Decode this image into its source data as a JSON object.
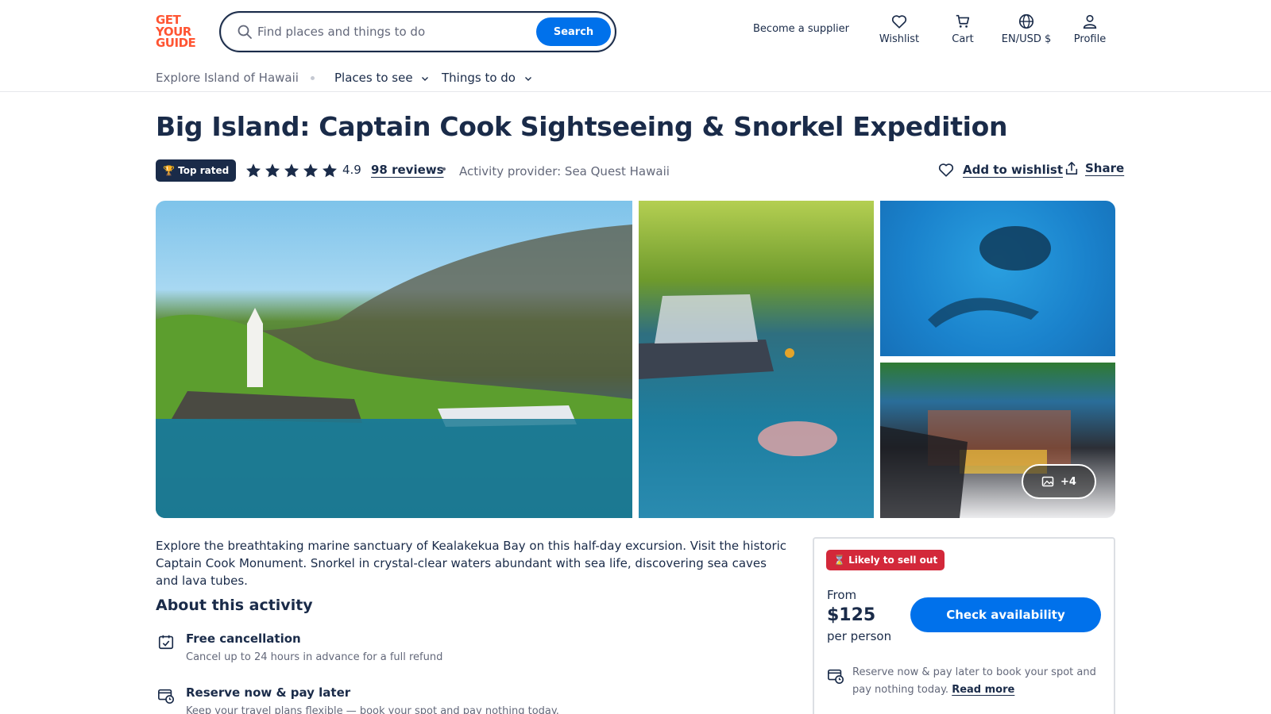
{
  "header": {
    "logo_lines": [
      "GET",
      "YOUR",
      "GUIDE"
    ],
    "search": {
      "placeholder": "Find places and things to do",
      "button_label": "Search"
    },
    "supplier_link": "Become a supplier",
    "nav": [
      {
        "label": "Wishlist",
        "icon": "heart-icon"
      },
      {
        "label": "Cart",
        "icon": "cart-icon"
      },
      {
        "label": "EN/USD $",
        "icon": "globe-icon"
      },
      {
        "label": "Profile",
        "icon": "profile-icon"
      }
    ]
  },
  "subnav": {
    "explore": "Explore Island of Hawaii",
    "menus": [
      {
        "label": "Places to see"
      },
      {
        "label": "Things to do"
      }
    ]
  },
  "activity": {
    "title": "Big Island: Captain Cook Sightseeing & Snorkel Expedition",
    "badge": "Top rated",
    "rating": "4.9",
    "stars": 5,
    "reviews": "98 reviews",
    "provider": "Activity provider: Sea Quest Hawaii",
    "add_to_wishlist": "Add to wishlist",
    "share": "Share",
    "more_photos": "+4",
    "description": "Explore the breathtaking marine sanctuary of Kealakekua Bay on this half-day excursion. Visit the historic Captain Cook Monument. Snorkel in crystal-clear waters abundant with sea life, discovering sea caves and lava tubes."
  },
  "about": {
    "title": "About this activity",
    "features": [
      {
        "icon": "calendar-check-icon",
        "title": "Free cancellation",
        "subtitle": "Cancel up to 24 hours in advance for a full refund"
      },
      {
        "icon": "payment-later-icon",
        "title": "Reserve now & pay later",
        "subtitle": "Keep your travel plans flexible — book your spot and pay nothing today."
      }
    ]
  },
  "booking": {
    "badge": "Likely to sell out",
    "from": "From",
    "price": "$125",
    "per": "per person",
    "cta": "Check availability",
    "note": "Reserve now & pay later to book your spot and pay nothing today.",
    "note_link": "Read more"
  },
  "colors": {
    "brand": "#ff5533",
    "primary_blue": "#0071eb",
    "navy": "#1a2b49",
    "alert_red": "#d3283a",
    "star": "#1a2b49"
  }
}
